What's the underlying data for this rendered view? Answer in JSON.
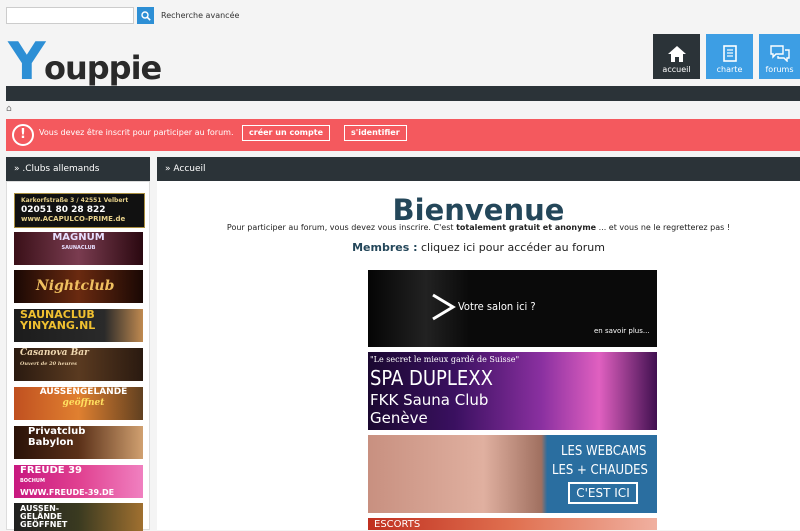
{
  "topbar": {
    "search_placeholder": "",
    "advanced_search_label": "Recherche avancée"
  },
  "logo": {
    "text_y": "Y",
    "text_rest": "ouppie",
    "brand_color": "#2d8fd5"
  },
  "nav": [
    {
      "label": "accueil",
      "icon": "home-icon"
    },
    {
      "label": "charte",
      "icon": "document-icon"
    },
    {
      "label": "forums",
      "icon": "chat-icon"
    }
  ],
  "alert": {
    "icon": "!",
    "message": "Vous devez être inscrit pour participer au forum.",
    "create_account": "créer un compte",
    "login": "s'identifier",
    "color": "#f4595e"
  },
  "sidebar": {
    "title": "» .Clubs allemands",
    "ads": [
      {
        "lines": [
          "Karkorfstraße 3 / 42551 Velbert",
          "02051 80 28 822",
          "www.ACAPULCO-PRIME.de"
        ]
      },
      {
        "lines": [
          "MAGNUM",
          "SAUNACLUB"
        ]
      },
      {
        "lines": [
          "Nightclub"
        ]
      },
      {
        "lines": [
          "SAUNACLUB",
          "YINYANG.NL"
        ]
      },
      {
        "lines": [
          "Casanova Bar",
          "Ouvert de 20 heures"
        ]
      },
      {
        "lines": [
          "AUSSENGELÄNDE",
          "geöffnet"
        ]
      },
      {
        "lines": [
          "Privatclub",
          "Babylon"
        ]
      },
      {
        "lines": [
          "FREUDE 39",
          "BOCHUM",
          "WWW.FREUDE-39.DE"
        ]
      },
      {
        "lines": [
          "AUSSEN-",
          "GELÄNDE",
          "GEÖFFNET"
        ]
      }
    ]
  },
  "main": {
    "breadcrumb": "» Accueil",
    "title": "Bienvenue",
    "subtitle_pre": "Pour participer au forum, vous devez vous inscrire. C'est ",
    "subtitle_bold": "totalement gratuit et anonyme",
    "subtitle_post": " ... et vous ne le regretterez pas !",
    "members_bold": "Membres :",
    "members_text": " cliquez ici pour accéder au forum",
    "banners": [
      {
        "text": "Votre salon ici ?",
        "small": "en savoir plus..."
      },
      {
        "line1": "\"Le secret le mieux gardé de Suisse\"",
        "line2": "SPA DUPLEXX",
        "line3": "FKK Sauna Club",
        "line4": "Genève"
      },
      {
        "line1": "LES WEBCAMS",
        "line2": "LES + CHAUDES",
        "button": "C'EST ICI"
      },
      {
        "text": "ESCORTS"
      }
    ]
  }
}
